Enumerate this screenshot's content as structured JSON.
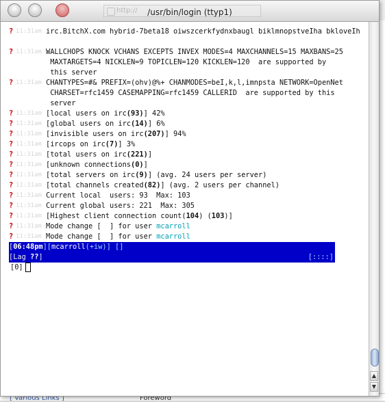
{
  "window": {
    "title": "/usr/bin/login (ttyp1)",
    "ghost_url": "http://"
  },
  "lines": [
    {
      "type": "q",
      "msg": "irc.BitchX.com hybrid-7beta18 oiwszcerkfydnxbaugl biklmnopstveIha bkloveIh"
    },
    {
      "type": "q",
      "msg": "WALLCHOPS KNOCK VCHANS EXCEPTS INVEX MODES=4 MAXCHANNELS=15 MAXBANS=25"
    },
    {
      "type": "cont",
      "msg": " MAXTARGETS=4 NICKLEN=9 TOPICLEN=120 KICKLEN=120  are supported by"
    },
    {
      "type": "cont",
      "msg": " this server"
    },
    {
      "type": "q",
      "msg": "CHANTYPES=#& PREFIX=(ohv)@%+ CHANMODES=beI,k,l,imnpsta NETWORK=OpenNet"
    },
    {
      "type": "cont",
      "msg": " CHARSET=rfc1459 CASEMAPPING=rfc1459 CALLERID  are supported by this"
    },
    {
      "type": "cont",
      "msg": " server"
    }
  ],
  "stats": [
    {
      "pre": "[",
      "label": "local users on irc",
      "val": "93",
      "post": "] 42%"
    },
    {
      "pre": "[",
      "label": "global users on irc",
      "val": "14",
      "post": "] 6%"
    },
    {
      "pre": "[",
      "label": "invisible users on irc",
      "val": "207",
      "post": "] 94%"
    },
    {
      "pre": "[",
      "label": "ircops on irc",
      "val": "7",
      "post": "] 3%"
    },
    {
      "pre": "[",
      "label": "total users on irc",
      "val": "221",
      "post": "]"
    },
    {
      "pre": "[",
      "label": "unknown connections",
      "val": "0",
      "post": "]"
    },
    {
      "pre": "[",
      "label": "total servers on irc",
      "val": "9",
      "post": "] (avg. 24 users per server)"
    },
    {
      "pre": "[",
      "label": "total channels created",
      "val": "82",
      "post": "] (avg. 2 users per channel)"
    }
  ],
  "plain_lines": [
    "Current local  users: 93  Max: 103",
    "Current global users: 221  Max: 305"
  ],
  "highest": {
    "label": "[Highest client connection count(",
    "val1": "104",
    "mid": ") (",
    "val2": "103",
    "end": ")]"
  },
  "mode_changes": [
    {
      "text": "Mode change [  ] for user ",
      "nick": "mcarroll"
    },
    {
      "text": "Mode change [  ] for user ",
      "nick": "mcarroll"
    }
  ],
  "timestamp_placeholder": "11:31am",
  "statusbar": {
    "open": "[",
    "time": "06:48pm",
    "mid": "][",
    "nick": "mcarroll",
    "mode": "(+iw)",
    "close": "] []"
  },
  "lagbar": {
    "left": "[Lag ",
    "value": "??",
    "right_bracket": "]",
    "right": "[::::]"
  },
  "prompt": "[0]",
  "background": {
    "footer_left": "[ Various Links ]",
    "footer_mid": "Foreword"
  },
  "colors": {
    "error_marker": "#c80000",
    "statusbar": "#0000c8",
    "nick": "#00a0b4"
  }
}
